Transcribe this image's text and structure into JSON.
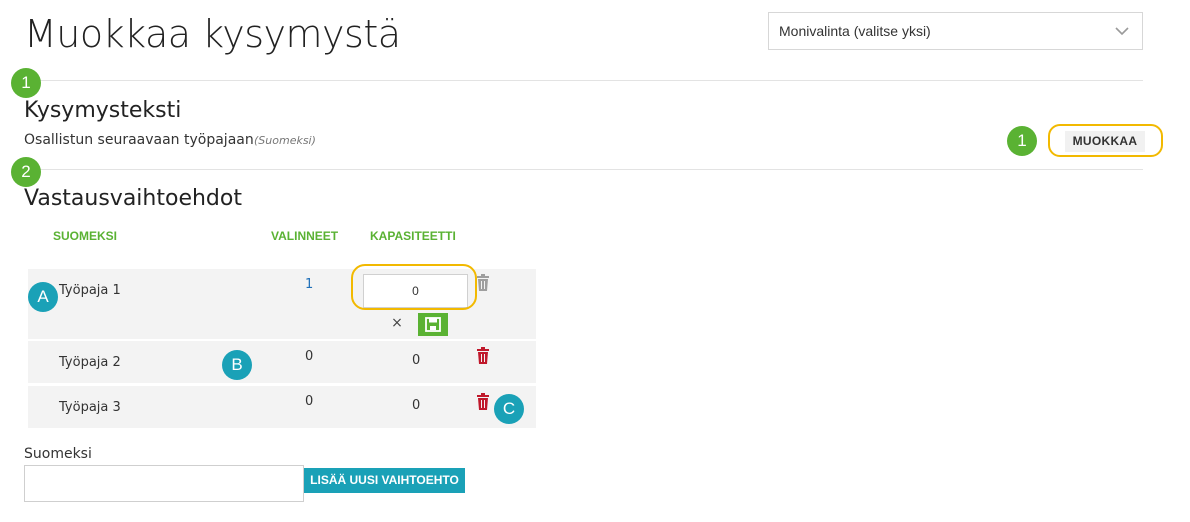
{
  "page": {
    "title": "Muokkaa kysymystä",
    "type_select": {
      "value": "Monivalinta (valitse yksi)"
    }
  },
  "question": {
    "section_title": "Kysymysteksti",
    "text": "Osallistun seuraavaan työpajaan",
    "language_note": "(Suomeksi)",
    "edit_label": "MUOKKAA"
  },
  "options": {
    "section_title": "Vastausvaihtoehdot",
    "columns": [
      "SUOMEKSI",
      "VALINNEET",
      "KAPASITEETTI"
    ],
    "rows": [
      {
        "name": "Työpaja 1",
        "selected": "1",
        "capacity": "0"
      },
      {
        "name": "Työpaja 2",
        "selected": "0",
        "capacity": "0"
      },
      {
        "name": "Työpaja 3",
        "selected": "0",
        "capacity": "0"
      }
    ],
    "cancel_glyph": "×"
  },
  "add_option": {
    "label": "Suomeksi",
    "value": "",
    "button_label": "LISÄÄ UUSI VAIHTOEHTO"
  },
  "annotations": {
    "step_one": "1",
    "step_two": "2",
    "marker_a": "A",
    "marker_b": "B",
    "marker_c": "C"
  },
  "colors": {
    "accent_green": "#5ab233",
    "accent_teal": "#1aa1b7",
    "highlight": "#f2b900",
    "delete_red": "#c0182b",
    "delete_disabled": "#9e9e9e"
  },
  "icons": {
    "dropdown": "chevron-down-icon",
    "delete": "trash-icon",
    "cancel": "close-icon",
    "save": "floppy-disk-icon"
  }
}
